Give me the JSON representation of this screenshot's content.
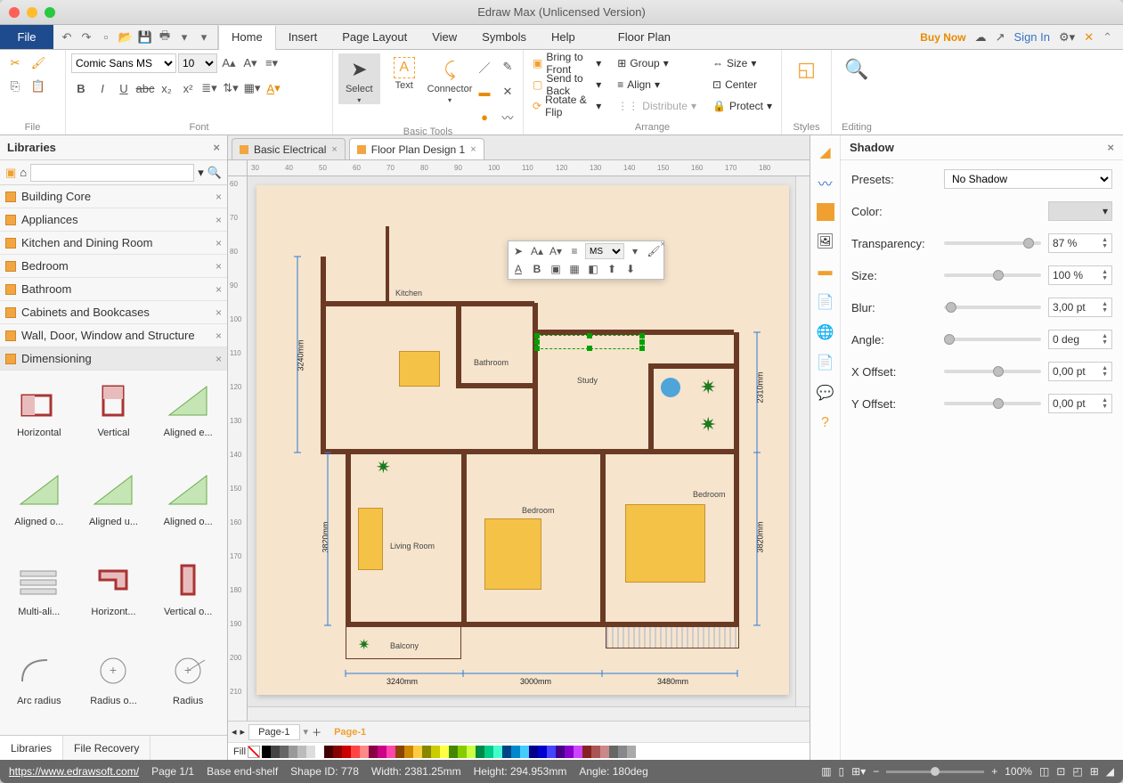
{
  "window_title": "Edraw Max (Unlicensed Version)",
  "menubar": {
    "file": "File",
    "tabs": [
      "Home",
      "Insert",
      "Page Layout",
      "View",
      "Symbols",
      "Help",
      "Floor Plan"
    ],
    "active_tab": "Home",
    "buy_now": "Buy Now",
    "sign_in": "Sign In"
  },
  "ribbon": {
    "file_group_label": "File",
    "font_group_label": "Font",
    "font_name": "Comic Sans MS",
    "font_size": "10",
    "basic_tools_label": "Basic Tools",
    "basic_tools": {
      "select": "Select",
      "text": "Text",
      "connector": "Connector"
    },
    "arrange_label": "Arrange",
    "arrange": {
      "bring_front": "Bring to Front",
      "send_back": "Send to Back",
      "rotate_flip": "Rotate & Flip",
      "group": "Group",
      "align": "Align",
      "distribute": "Distribute",
      "size": "Size",
      "center": "Center",
      "protect": "Protect"
    },
    "styles_label": "Styles",
    "editing_label": "Editing"
  },
  "left_panel": {
    "title": "Libraries",
    "search_placeholder": "",
    "categories": [
      "Building Core",
      "Appliances",
      "Kitchen and Dining Room",
      "Bedroom",
      "Bathroom",
      "Cabinets and Bookcases",
      "Wall, Door, Window and Structure",
      "Dimensioning"
    ],
    "active_category": "Dimensioning",
    "shapes": [
      "Horizontal",
      "Vertical",
      "Aligned e...",
      "Aligned o...",
      "Aligned u...",
      "Aligned o...",
      "Multi-ali...",
      "Horizont...",
      "Vertical o...",
      "Arc radius",
      "Radius o...",
      "Radius"
    ],
    "bottom_tabs": [
      "Libraries",
      "File Recovery"
    ]
  },
  "doc_tabs": [
    {
      "label": "Basic Electrical",
      "active": false
    },
    {
      "label": "Floor Plan Design 1",
      "active": true
    }
  ],
  "ruler_h": [
    30,
    40,
    50,
    60,
    70,
    80,
    90,
    100,
    110,
    120,
    130,
    140,
    150,
    160,
    170,
    180
  ],
  "ruler_v": [
    60,
    70,
    80,
    90,
    100,
    110,
    120,
    130,
    140,
    150,
    160,
    170,
    180,
    190,
    200,
    210
  ],
  "floorplan": {
    "rooms": [
      "Kitchen",
      "Bathroom",
      "Study",
      "Bedroom",
      "Bedroom",
      "Living Room",
      "Balcony"
    ],
    "dimensions": {
      "left_upper": "3240mm",
      "left_lower": "3820mm",
      "right_upper": "2310mm",
      "right_lower": "3820mm",
      "bottom_1": "3240mm",
      "bottom_2": "3000mm",
      "bottom_3": "3480mm"
    },
    "mini_toolbar_font": "MS"
  },
  "page_tabs": {
    "pages": [
      "Page-1"
    ],
    "current": "Page-1",
    "fill_label": "Fill"
  },
  "right_panel": {
    "title": "Shadow",
    "presets_label": "Presets:",
    "presets_value": "No Shadow",
    "color_label": "Color:",
    "transparency_label": "Transparency:",
    "transparency_value": "87 %",
    "size_label": "Size:",
    "size_value": "100 %",
    "blur_label": "Blur:",
    "blur_value": "3,00 pt",
    "angle_label": "Angle:",
    "angle_value": "0 deg",
    "xoffset_label": "X Offset:",
    "xoffset_value": "0,00 pt",
    "yoffset_label": "Y Offset:",
    "yoffset_value": "0,00 pt"
  },
  "statusbar": {
    "url": "https://www.edrawsoft.com/",
    "page": "Page 1/1",
    "shape_name": "Base end-shelf",
    "shape_id": "Shape ID: 778",
    "width": "Width: 2381.25mm",
    "height": "Height: 294.953mm",
    "angle": "Angle: 180deg",
    "zoom": "100%"
  }
}
